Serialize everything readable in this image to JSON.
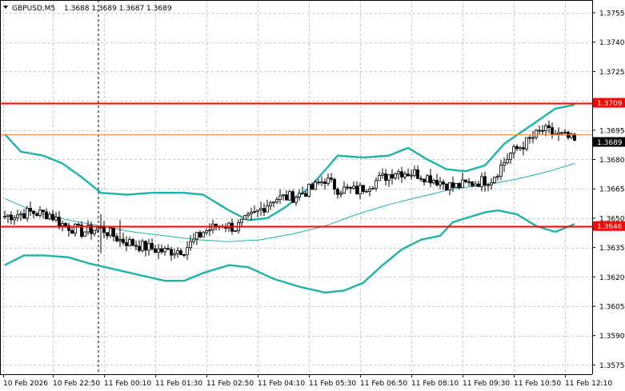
{
  "header": {
    "symbol_timeframe": "GBPUSD,M5",
    "ohlc": "1.3688 1.3689 1.3687 1.3689"
  },
  "colors": {
    "background": "#ffffff",
    "grid": "#c8c8c8",
    "bands": "#20b2aa",
    "level_line": "#ff0000",
    "current_price_line": "#ff8c40",
    "current_price_label_bg": "#000000",
    "level_label_bg": "#ff0000",
    "candle": "#000000"
  },
  "price_axis": {
    "ticks": [
      "1.3755",
      "1.3740",
      "1.3725",
      "1.3710",
      "1.3695",
      "1.3680",
      "1.3665",
      "1.3650",
      "1.3635",
      "1.3620",
      "1.3605",
      "1.3590",
      "1.3575"
    ]
  },
  "time_axis": {
    "ticks": [
      "10 Feb 2026",
      "10 Feb 22:50",
      "11 Feb 00:10",
      "11 Feb 01:30",
      "11 Feb 02:50",
      "11 Feb 04:10",
      "11 Feb 05:30",
      "11 Feb 06:50",
      "11 Feb 08:10",
      "11 Feb 09:30",
      "11 Feb 10:50",
      "11 Feb 12:10"
    ]
  },
  "levels": [
    {
      "label": "1.3709",
      "price": 1.3709
    },
    {
      "label": "1.3646",
      "price": 1.3646
    }
  ],
  "current_price": {
    "label": "1.3689",
    "price": 1.3689
  },
  "chart_data": {
    "type": "candlestick",
    "symbol": "GBPUSD",
    "timeframe": "M5",
    "ylim": [
      1.357,
      1.3762
    ],
    "indicators": [
      "Bollinger Bands"
    ],
    "grid": true,
    "close_path_anchors": [
      [
        0,
        1.3651
      ],
      [
        8,
        1.3653
      ],
      [
        14,
        1.3652
      ],
      [
        18,
        1.3647
      ],
      [
        24,
        1.3643
      ],
      [
        30,
        1.3645
      ],
      [
        36,
        1.3639
      ],
      [
        42,
        1.3636
      ],
      [
        50,
        1.3633
      ],
      [
        56,
        1.3634
      ],
      [
        62,
        1.3643
      ],
      [
        68,
        1.3647
      ],
      [
        72,
        1.3645
      ],
      [
        78,
        1.3652
      ],
      [
        84,
        1.366
      ],
      [
        90,
        1.3661
      ],
      [
        96,
        1.3665
      ],
      [
        100,
        1.367
      ],
      [
        104,
        1.3665
      ],
      [
        110,
        1.3664
      ],
      [
        116,
        1.3669
      ],
      [
        122,
        1.3674
      ],
      [
        128,
        1.3673
      ],
      [
        134,
        1.367
      ],
      [
        140,
        1.3666
      ],
      [
        146,
        1.3668
      ],
      [
        152,
        1.367
      ],
      [
        158,
        1.3683
      ],
      [
        164,
        1.369
      ],
      [
        168,
        1.3695
      ],
      [
        172,
        1.3693
      ],
      [
        176,
        1.3691
      ],
      [
        178,
        1.3689
      ]
    ],
    "band_upper_anchors": [
      [
        0,
        1.3693
      ],
      [
        5,
        1.3684
      ],
      [
        12,
        1.3682
      ],
      [
        18,
        1.3678
      ],
      [
        24,
        1.3671
      ],
      [
        30,
        1.3663
      ],
      [
        38,
        1.3662
      ],
      [
        46,
        1.3663
      ],
      [
        56,
        1.3663
      ],
      [
        62,
        1.3662
      ],
      [
        70,
        1.3654
      ],
      [
        76,
        1.3649
      ],
      [
        82,
        1.365
      ],
      [
        88,
        1.3656
      ],
      [
        96,
        1.3667
      ],
      [
        104,
        1.3682
      ],
      [
        112,
        1.3681
      ],
      [
        120,
        1.3682
      ],
      [
        126,
        1.3686
      ],
      [
        132,
        1.368
      ],
      [
        138,
        1.3675
      ],
      [
        144,
        1.3674
      ],
      [
        150,
        1.3677
      ],
      [
        156,
        1.3688
      ],
      [
        164,
        1.3697
      ],
      [
        172,
        1.3706
      ],
      [
        178,
        1.3708
      ]
    ],
    "band_middle_anchors": [
      [
        0,
        1.366
      ],
      [
        10,
        1.3653
      ],
      [
        20,
        1.3649
      ],
      [
        30,
        1.3646
      ],
      [
        40,
        1.3643
      ],
      [
        50,
        1.3641
      ],
      [
        60,
        1.3639
      ],
      [
        70,
        1.3638
      ],
      [
        80,
        1.3639
      ],
      [
        90,
        1.3642
      ],
      [
        100,
        1.3646
      ],
      [
        110,
        1.3652
      ],
      [
        120,
        1.3657
      ],
      [
        130,
        1.3661
      ],
      [
        140,
        1.3665
      ],
      [
        150,
        1.3667
      ],
      [
        160,
        1.367
      ],
      [
        170,
        1.3674
      ],
      [
        178,
        1.3678
      ]
    ],
    "band_lower_anchors": [
      [
        0,
        1.3626
      ],
      [
        6,
        1.3631
      ],
      [
        12,
        1.3631
      ],
      [
        20,
        1.363
      ],
      [
        26,
        1.3627
      ],
      [
        34,
        1.3624
      ],
      [
        42,
        1.3621
      ],
      [
        50,
        1.3618
      ],
      [
        56,
        1.3618
      ],
      [
        62,
        1.3622
      ],
      [
        70,
        1.3626
      ],
      [
        76,
        1.3625
      ],
      [
        84,
        1.3619
      ],
      [
        92,
        1.3615
      ],
      [
        100,
        1.3612
      ],
      [
        106,
        1.3613
      ],
      [
        112,
        1.3617
      ],
      [
        118,
        1.3626
      ],
      [
        124,
        1.3634
      ],
      [
        130,
        1.3639
      ],
      [
        136,
        1.3641
      ],
      [
        140,
        1.3648
      ],
      [
        146,
        1.3651
      ],
      [
        150,
        1.3653
      ],
      [
        154,
        1.3654
      ],
      [
        160,
        1.3652
      ],
      [
        166,
        1.3646
      ],
      [
        172,
        1.3643
      ],
      [
        178,
        1.3647
      ]
    ]
  }
}
